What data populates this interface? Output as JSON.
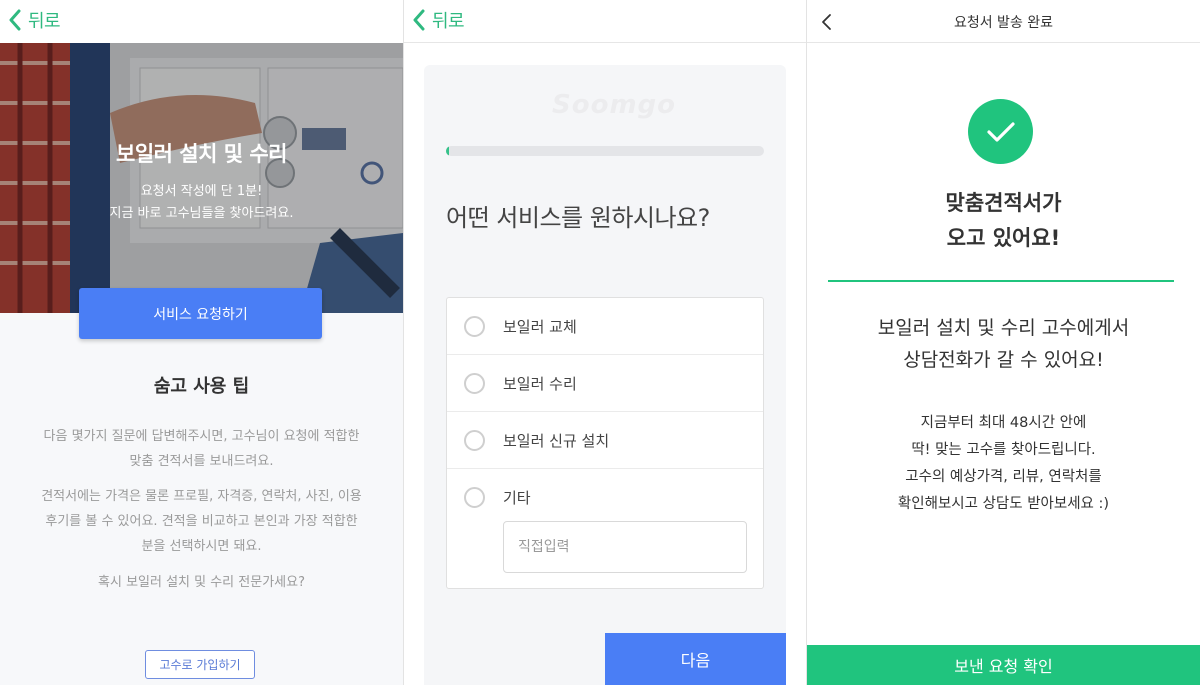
{
  "screen1": {
    "back_label": "뒤로",
    "hero": {
      "title": "보일러 설치 및 수리",
      "subtitle_line1": "요청서 작성에 단 1분!",
      "subtitle_line2": "지금 바로 고수님들을 찾아드려요."
    },
    "request_button": "서비스 요청하기",
    "tips": {
      "title": "숨고 사용 팁",
      "paragraph1_line1": "다음 몇가지 질문에 답변해주시면, 고수님이 요청에 적합한",
      "paragraph1_line2": "맞춤 견적서를 보내드려요.",
      "paragraph2_line1": "견적서에는 가격은 물론 프로필, 자격증, 연락처, 사진, 이용",
      "paragraph2_line2": "후기를 볼 수 있어요. 견적을 비교하고 본인과 가장 적합한",
      "paragraph2_line3": "분을 선택하시면 돼요.",
      "question": "혹시 보일러 설치 및 수리 전문가세요?"
    },
    "signup_button": "고수로 가입하기"
  },
  "screen2": {
    "back_label": "뒤로",
    "watermark": "Soomgo",
    "progress_percent": 1,
    "question": "어떤 서비스를 원하시나요?",
    "options": [
      "보일러 교체",
      "보일러 수리",
      "보일러 신규 설치",
      "기타"
    ],
    "other_placeholder": "직접입력",
    "next_button": "다음"
  },
  "screen3": {
    "title": "요청서 발송 완료",
    "done_line1": "맞춤견적서가",
    "done_line2": "오고 있어요!",
    "main_line1": "보일러 설치 및 수리 고수에게서",
    "main_line2": "상담전화가 갈 수 있어요!",
    "sub_line1": "지금부터 최대 48시간 안에",
    "sub_line2": "딱! 맞는 고수를 찾아드립니다.",
    "sub_line3": "고수의 예상가격, 리뷰, 연락처를",
    "sub_line4": "확인해보시고 상담도 받아보세요 :)",
    "confirm_button": "보낸 요청 확인"
  },
  "colors": {
    "brand_green": "#20c47e",
    "primary_blue": "#4a7ef5",
    "back_green": "#2fb980"
  }
}
